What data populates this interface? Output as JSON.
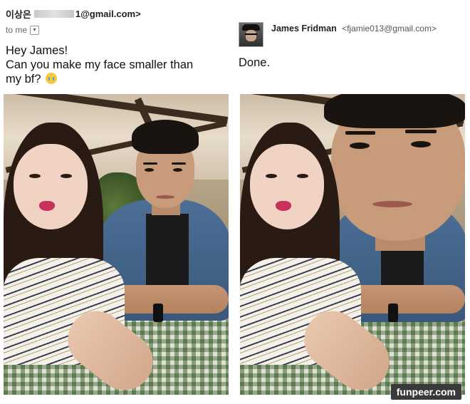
{
  "left_panel": {
    "sender": {
      "name": "이상은",
      "email_tail": "1@gmail.com>"
    },
    "recipient": {
      "label": "to me",
      "dropdown_icon": "chevron-down-icon"
    },
    "message": {
      "lines": [
        "Hey James!",
        "Can you make my face smaller than",
        "my bf?"
      ],
      "emoji": "crying-face-emoji"
    }
  },
  "right_panel": {
    "sender": {
      "name": "James Fridman",
      "email": "<fjamie013@gmail.com>"
    },
    "reply": "Done."
  },
  "watermark": "funpeer.com",
  "colors": {
    "table_check": "#6a8a55",
    "denim": "#4d6f96"
  }
}
